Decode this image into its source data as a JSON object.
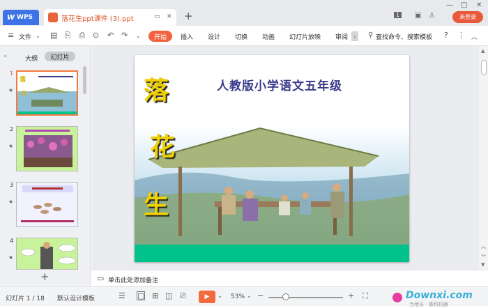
{
  "app": {
    "wps_tab": "WPS",
    "doc_tab": "落花生ppt课件 (3).ppt",
    "login": "未登录",
    "page_badge": "1"
  },
  "ribbon": {
    "file": "文件",
    "start": "开始",
    "tabs": [
      "插入",
      "设计",
      "切换",
      "动画",
      "幻灯片放映",
      "审阅"
    ],
    "search": "查找命令、搜索模板"
  },
  "sidebar": {
    "outline": "大纲",
    "slides": "幻灯片",
    "slide_nums": [
      "1",
      "2",
      "3",
      "4"
    ],
    "thumb2_title": "落花生的小学课本",
    "thumb3_title": "落花生，说花生",
    "thumb3_q": "请你说一说，花生有什么好处？"
  },
  "slide": {
    "subtitle": "人教版小学语文五年级",
    "chars": [
      "落",
      "花",
      "生"
    ]
  },
  "notes": {
    "placeholder": "单击此处添加备注"
  },
  "status": {
    "slide_count": "幻灯片 1 / 18",
    "template": "默认设计模板",
    "zoom": "53%"
  },
  "watermark": {
    "text": "Downxi.com",
    "sub": "当地乐 · 事利机器"
  }
}
